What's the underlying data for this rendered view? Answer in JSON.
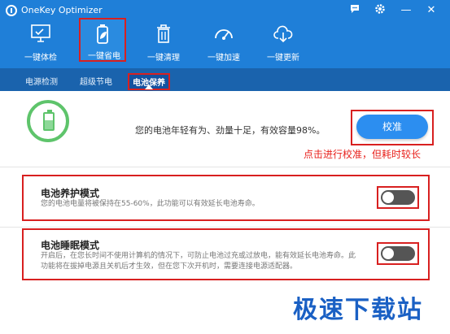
{
  "app": {
    "title": "OneKey Optimizer"
  },
  "titlebar": {
    "chat_icon": "chat-icon",
    "settings_icon": "gear-icon",
    "minimize": "—",
    "close": "✕"
  },
  "nav": [
    {
      "label": "一键体检",
      "icon": "monitor-check-icon"
    },
    {
      "label": "一键省电",
      "icon": "battery-leaf-icon"
    },
    {
      "label": "一键清理",
      "icon": "trash-icon"
    },
    {
      "label": "一键加速",
      "icon": "speedometer-icon"
    },
    {
      "label": "一键更新",
      "icon": "cloud-download-icon"
    }
  ],
  "subtabs": [
    "电源检测",
    "超级节电",
    "电池保养"
  ],
  "status": {
    "text": "您的电池年轻有为、劲量十足，有效容量98%。",
    "capacity_percent": 98
  },
  "calibrate": {
    "label": "校准",
    "note": "点击进行校准，但耗时较长"
  },
  "sections": {
    "care": {
      "title": "电池养护模式",
      "desc": "您的电池电量将被保持在55-60%，此功能可以有效延长电池寿命。",
      "enabled": false
    },
    "sleep": {
      "title": "电池睡眠模式",
      "desc_line1": "开启后，在您长时间不使用计算机的情况下，可防止电池过充或过放电，能有效延长电池寿命。此",
      "desc_line2": "功能将在拔掉电源且关机后才生效，但在您下次开机时，需要连接电源适配器。",
      "enabled": false
    }
  },
  "watermark": "极速下载站",
  "colors": {
    "header": "#1f7fd8",
    "subtabs": "#1a63ad",
    "accent": "#2c8ef0",
    "highlight": "#d82020",
    "battery": "#5ec46b"
  }
}
